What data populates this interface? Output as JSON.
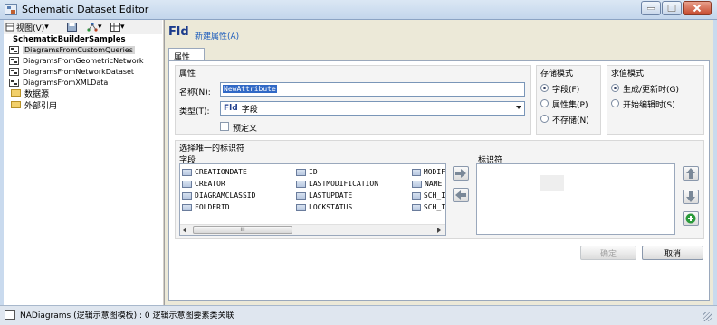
{
  "window": {
    "title": "Schematic Dataset Editor"
  },
  "toolbar": {
    "view_label": "视图(V)",
    "view_arrow": "▾",
    "layout_arrow": "▾",
    "options_arrow": "▾"
  },
  "tree": {
    "root": "SchematicBuilderSamples",
    "items": [
      {
        "label": "DiagramsFromCustomQueries",
        "selected": true
      },
      {
        "label": "DiagramsFromGeometricNetwork",
        "selected": false
      },
      {
        "label": "DiagramsFromNetworkDataset",
        "selected": false
      },
      {
        "label": "DiagramsFromXMLData",
        "selected": false
      }
    ],
    "folders": [
      "数据源",
      "外部引用"
    ]
  },
  "header": {
    "big_title": "Fld",
    "new_attribute_link": "新建属性(A)"
  },
  "tabs": [
    {
      "label": "属性",
      "active": true
    }
  ],
  "properties": {
    "group_label": "属性",
    "name_label": "名称(N):",
    "name_value": "NewAttribute",
    "type_label": "类型(T):",
    "type_prefix": "Fld",
    "type_value": "字段",
    "predefined_label": "预定义",
    "predefined_checked": false
  },
  "storage_mode": {
    "title": "存储模式",
    "options": [
      {
        "label": "字段(F)",
        "selected": true
      },
      {
        "label": "属性集(P)",
        "selected": false
      },
      {
        "label": "不存储(N)",
        "selected": false
      }
    ]
  },
  "evaluation_mode": {
    "title": "求值模式",
    "options": [
      {
        "label": "生成/更新时(G)",
        "selected": true
      },
      {
        "label": "开始编辑时(S)",
        "selected": false
      }
    ]
  },
  "unique_identifier": {
    "title": "选择唯一的标识符",
    "fields_label": "字段",
    "identifiers_label": "标识符",
    "fields_col1": [
      "CREATIONDATE",
      "CREATOR",
      "DIAGRAMCLASSID",
      "FOLDERID"
    ],
    "fields_col2": [
      "ID",
      "LASTMODIFICATION",
      "LASTUPDATE",
      "LOCKSTATUS"
    ],
    "fields_col3": [
      "MODIF",
      "NAME",
      "SCH_I",
      "SCH_I"
    ],
    "scroll_thumb_glyph": "III",
    "identifiers": []
  },
  "buttons": {
    "ok": "确定",
    "cancel": "取消"
  },
  "status": {
    "text": "NADiagrams (逻辑示意图模板) : 0 逻辑示意图要素类关联"
  },
  "colors": {
    "selection": "#3169c6",
    "link": "#1c5cbc",
    "add_green": "#2a9a3a"
  }
}
